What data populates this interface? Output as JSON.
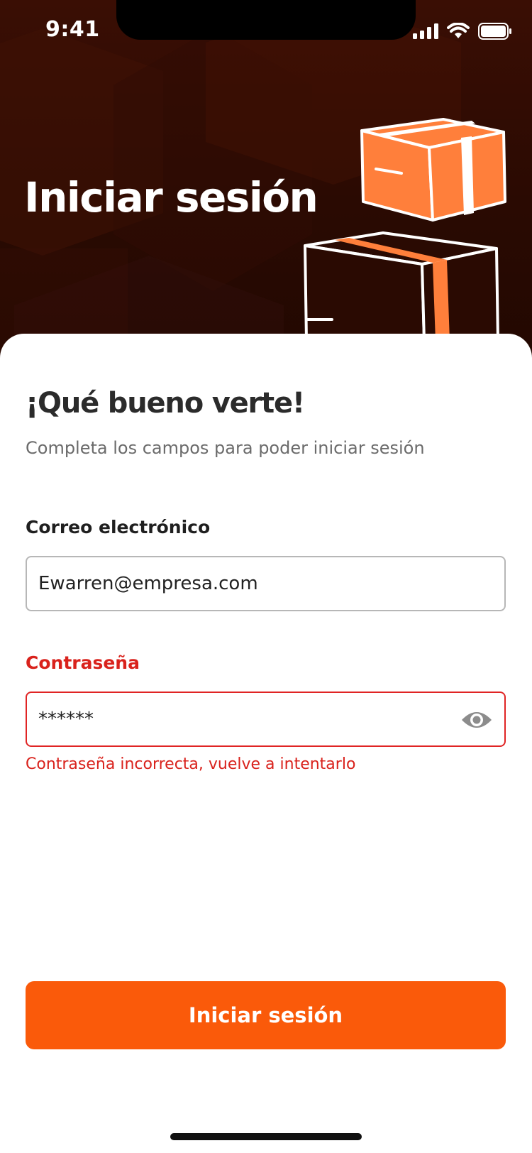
{
  "status_bar": {
    "time": "9:41"
  },
  "hero": {
    "title": "Iniciar sesión"
  },
  "form": {
    "greeting": "¡Qué bueno verte!",
    "subtitle": "Completa los campos para poder iniciar sesión",
    "email": {
      "label": "Correo electrónico",
      "value": "Ewarren@empresa.com"
    },
    "password": {
      "label": "Contraseña",
      "value": "******",
      "error": "Contraseña incorrecta, vuelve a intentarlo"
    }
  },
  "actions": {
    "submit_label": "Iniciar sesión"
  },
  "colors": {
    "accent": "#fa5a0a",
    "box_orange": "#ff7f3b",
    "error": "#d9221c",
    "hero_dark": "#2a0a02"
  },
  "icons": {
    "signal": "cellular-signal-icon",
    "wifi": "wifi-icon",
    "battery": "battery-icon",
    "eye": "eye-icon",
    "illustration": "package-boxes-illustration"
  }
}
